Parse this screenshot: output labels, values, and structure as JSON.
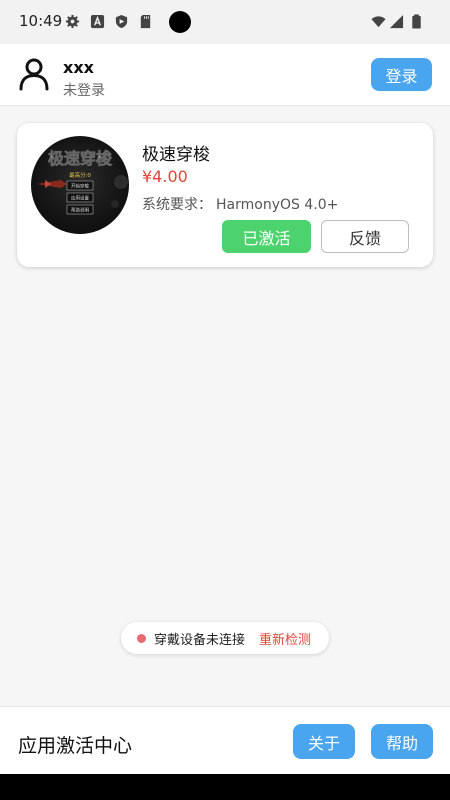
{
  "status_bar": {
    "time": "10:49",
    "icons": [
      "settings-icon",
      "a-icon",
      "shield-icon",
      "sd-card-icon",
      "wifi-icon",
      "signal-icon",
      "battery-icon"
    ]
  },
  "header": {
    "username": "xxx",
    "login_status": "未登录",
    "login_button": "登录"
  },
  "app_card": {
    "icon": "game-icon",
    "icon_text": {
      "title": "极速穿梭",
      "high_score": "最高分:0",
      "menu": [
        "开始穿梭",
        "应用设置",
        "帮助说明"
      ]
    },
    "title": "极速穿梭",
    "price": "¥4.00",
    "system_req_label": "系统要求：",
    "system_req_value": "HarmonyOS 4.0+",
    "activated_button": "已激活",
    "feedback_button": "反馈"
  },
  "device_status": {
    "text": "穿戴设备未连接",
    "recheck_label": "重新检测"
  },
  "bottom_bar": {
    "title": "应用激活中心",
    "about_button": "关于",
    "help_button": "帮助"
  },
  "colors": {
    "accent": "#4aa5ef",
    "success": "#4cd36d",
    "price": "#e2453a"
  }
}
